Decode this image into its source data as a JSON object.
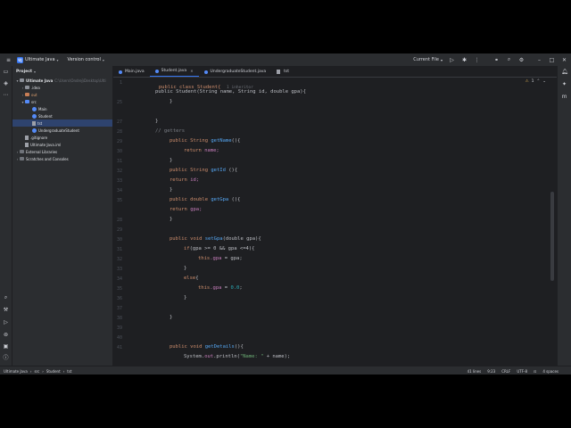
{
  "titlebar": {
    "project_initials": "UJ",
    "project_name": "Ultimate Java",
    "vcs_label": "Version control",
    "run_config": "Current File"
  },
  "project_panel": {
    "title": "Project",
    "root_name": "Ultimate Java",
    "root_path": "C:\\Users\\Ondrej\\Desktop\\Ulti",
    "items": [
      {
        "label": ".idea"
      },
      {
        "label": "out"
      },
      {
        "label": "src"
      },
      {
        "label": "Main"
      },
      {
        "label": "Student"
      },
      {
        "label": "tst"
      },
      {
        "label": "UndergraduateStudent"
      },
      {
        "label": ".gitignore"
      },
      {
        "label": "Ultimate Java.iml"
      },
      {
        "label": "External Libraries"
      },
      {
        "label": "Scratches and Consoles"
      }
    ]
  },
  "tabs": [
    {
      "label": "Main.java"
    },
    {
      "label": "Student.java"
    },
    {
      "label": "UndergraduateStudent.java"
    },
    {
      "label": "tst"
    }
  ],
  "editor": {
    "inspection_count": "1",
    "inheritor_hint": "1 inheritor",
    "line_numbers": [
      "1",
      "",
      "25",
      "",
      "27",
      "28",
      "29",
      "30",
      "31",
      "32",
      "33",
      "34",
      "35",
      "",
      "28",
      "29",
      "30",
      "31",
      "32",
      "33",
      "34",
      "35",
      "36",
      "37",
      "38",
      "39",
      "40",
      "41"
    ],
    "code": {
      "l1": "public class Student{",
      "l2": "public Student(String name, String id, double gpa){",
      "l3": "}",
      "l4": "}",
      "l5": "// getters",
      "l6a": "public String",
      "l6b": "getName",
      "l6c": "(){",
      "l7a": "return",
      "l7b": "name;",
      "l8": "}",
      "l9a": "public String",
      "l9b": "getId",
      "l9c": "(){",
      "l10a": "return",
      "l10b": "id;",
      "l11": "}",
      "l12a": "public double",
      "l12b": "getGpa",
      "l12c": "(){",
      "l13a": "return",
      "l13b": "gpa;",
      "l14": "}",
      "l15a": "public void",
      "l15b": "setGpa",
      "l15c": "(double gpa){",
      "l16a": "if",
      "l16b": "(gpa >= 0 && gpa <=4){",
      "l17a": "this",
      "l17b": ".gpa",
      "l17c": " = gpa;",
      "l18": "}",
      "l19a": "else",
      "l19b": "{",
      "l20a": "this",
      "l20b": ".gpa",
      "l20c": " = ",
      "l20d": "0.0",
      "l20e": ";",
      "l21": "}",
      "l22": "}",
      "l23a": "public void",
      "l23b": "getDetails",
      "l23c": "(){",
      "l24a": "System.",
      "l24b": "out",
      "l24c": ".println(",
      "l24d": "\"Name: \"",
      "l24e": " + name);"
    }
  },
  "statusbar": {
    "crumbs": [
      "Ultimate Java",
      "src",
      "Student",
      "tst"
    ],
    "line_info": "41 lines",
    "position": "9:23",
    "line_sep": "CRLF",
    "encoding": "UTF-8",
    "indent": "4 spaces"
  }
}
